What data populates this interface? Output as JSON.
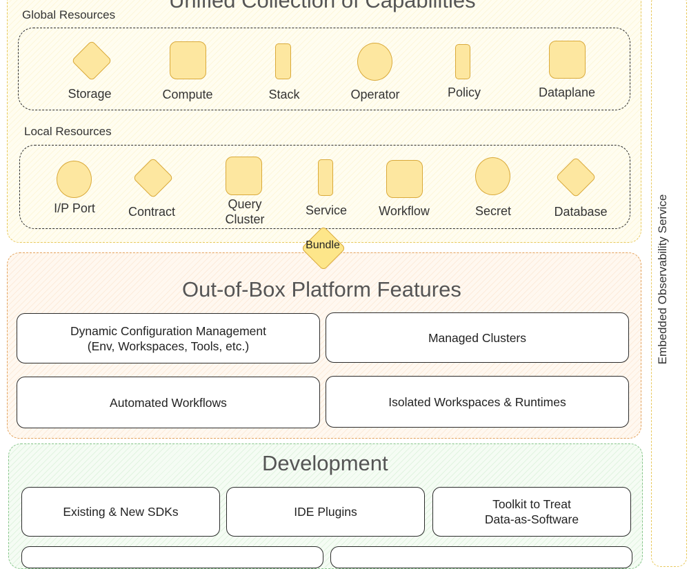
{
  "capabilities": {
    "title": "Unified Collection of Capabilities",
    "global_label": "Global Resources",
    "global_items": [
      "Storage",
      "Compute",
      "Stack",
      "Operator",
      "Policy",
      "Dataplane"
    ],
    "local_label": "Local Resources",
    "local_items": [
      "I/P Port",
      "Contract",
      "Query\nCluster",
      "Service",
      "Workflow",
      "Secret",
      "Database"
    ]
  },
  "bundle": "Bundle",
  "platform": {
    "title": "Out-of-Box Platform Features",
    "features": [
      "Dynamic Configuration Management\n(Env, Workspaces, Tools, etc.)",
      "Managed Clusters",
      "Automated Workflows",
      "Isolated Workspaces & Runtimes"
    ]
  },
  "development": {
    "title": "Development",
    "items": [
      "Existing & New SDKs",
      "IDE Plugins",
      "Toolkit to Treat\nData-as-Software"
    ]
  },
  "observability": "Embedded Observability Service",
  "colors": {
    "resource_fill": "#fde7a0",
    "resource_stroke": "#d9a93a",
    "capabilities_border": "#e8c85a",
    "platform_border": "#e3a15a",
    "development_border": "#86c58a"
  }
}
